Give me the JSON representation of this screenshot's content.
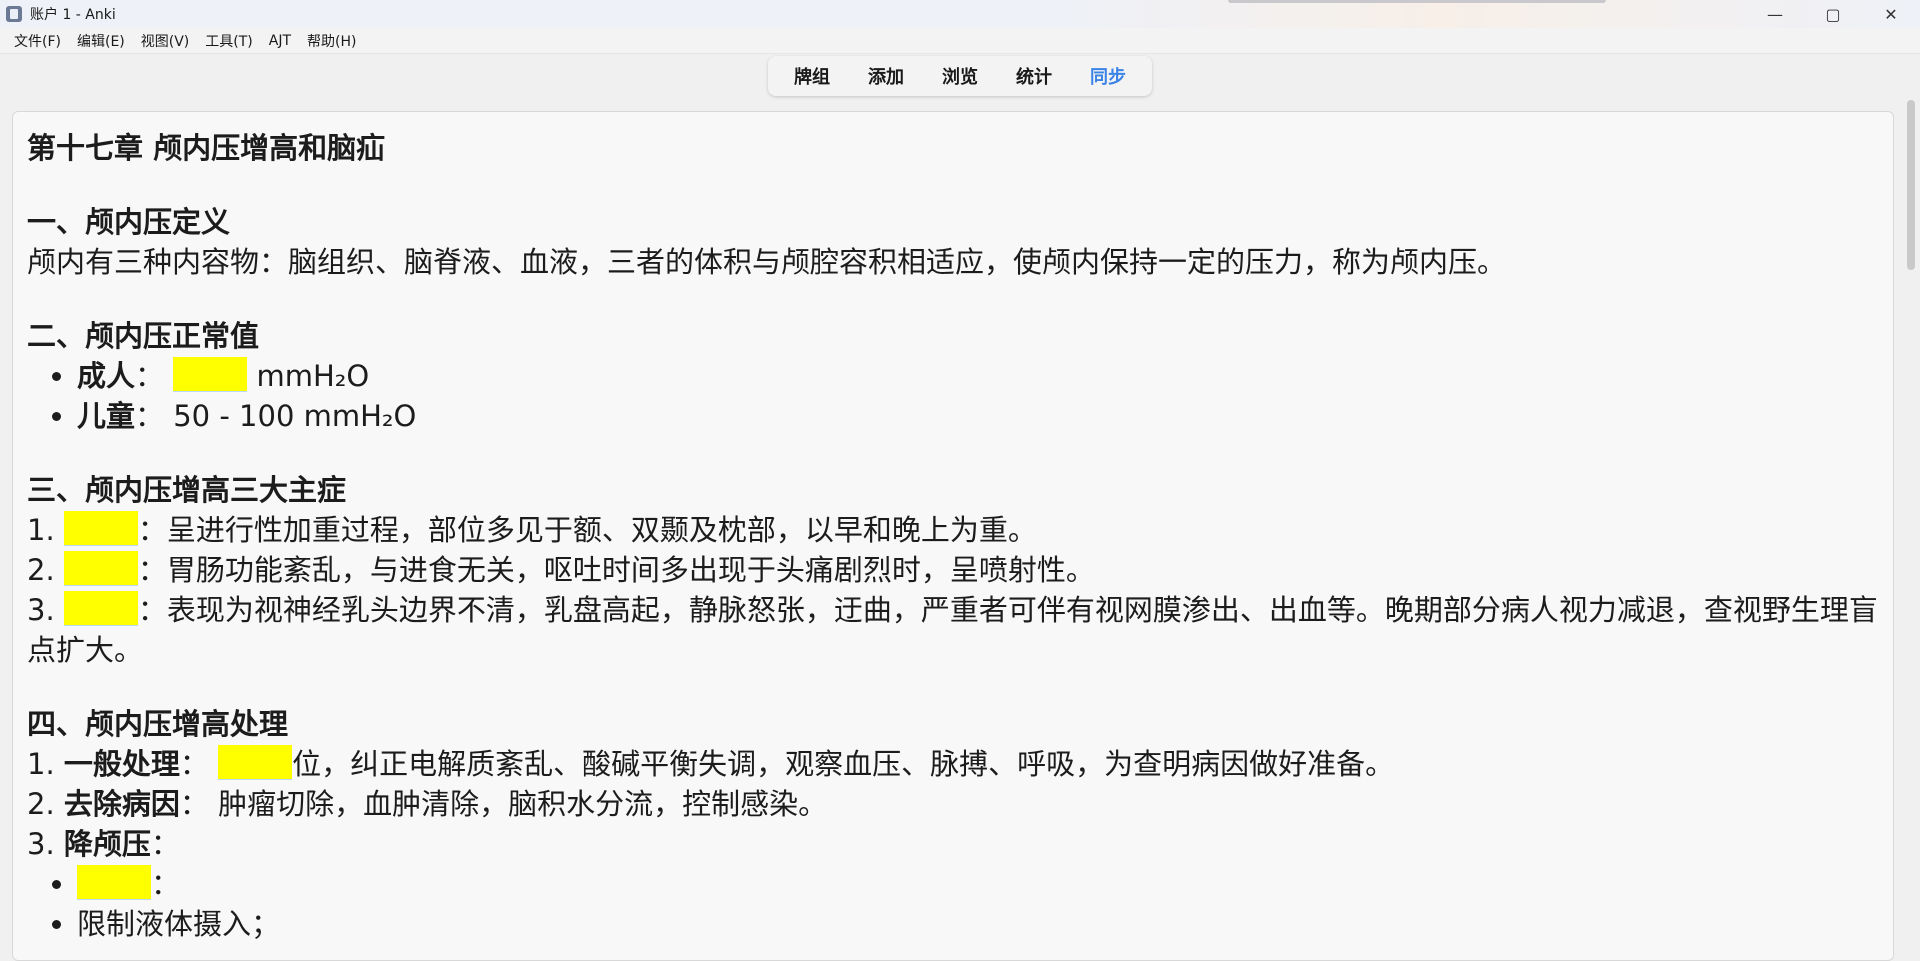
{
  "window": {
    "title": "账户 1 - Anki",
    "controls": {
      "minimize": "—",
      "maximize": "▢",
      "close": "✕"
    }
  },
  "menu": [
    "文件(F)",
    "编辑(E)",
    "视图(V)",
    "工具(T)",
    "AJT",
    "帮助(H)"
  ],
  "toolbar": [
    {
      "label": "牌组",
      "active": false
    },
    {
      "label": "添加",
      "active": false
    },
    {
      "label": "浏览",
      "active": false
    },
    {
      "label": "统计",
      "active": false
    },
    {
      "label": "同步",
      "active": true
    }
  ],
  "note": {
    "title": "第十七章 颅内压增高和脑疝",
    "s1": {
      "heading": "一、颅内压定义",
      "text": "颅内有三种内容物：脑组织、脑脊液、血液，三者的体积与颅腔容积相适应，使颅内保持一定的压力，称为颅内压。"
    },
    "s2": {
      "heading": "二、颅内压正常值",
      "adult_label": "成人",
      "adult_unit": "mmH₂O",
      "child_label": "儿童",
      "child_value": "50 - 100 mmH₂O"
    },
    "s3": {
      "heading": "三、颅内压增高三大主症",
      "items": [
        {
          "num": "1.",
          "text": "：呈进行性加重过程，部位多见于额、双颞及枕部，以早和晚上为重。"
        },
        {
          "num": "2.",
          "text": "：胃肠功能紊乱，与进食无关，呕吐时间多出现于头痛剧烈时，呈喷射性。"
        },
        {
          "num": "3.",
          "text": "：表现为视神经乳头边界不清，乳盘高起，静脉怒张，迂曲，严重者可伴有视网膜渗出、出血等。晚期部分病人视力减退，查视野生理盲点扩大。"
        }
      ]
    },
    "s4": {
      "heading": "四、颅内压增高处理",
      "items": [
        {
          "num": "1.",
          "label": "一般处理",
          "text": "位，纠正电解质紊乱、酸碱平衡失调，观察血压、脉搏、呼吸，为查明病因做好准备。"
        },
        {
          "num": "2.",
          "label": "去除病因",
          "text": "肿瘤切除，血肿清除，脑积水分流，控制感染。"
        },
        {
          "num": "3.",
          "label": "降颅压",
          "text": ""
        }
      ],
      "sub_items": [
        "：",
        "限制液体摄入；"
      ]
    }
  },
  "colors": {
    "cloze": "#ffff00",
    "active_tab": "#3a83e6"
  }
}
